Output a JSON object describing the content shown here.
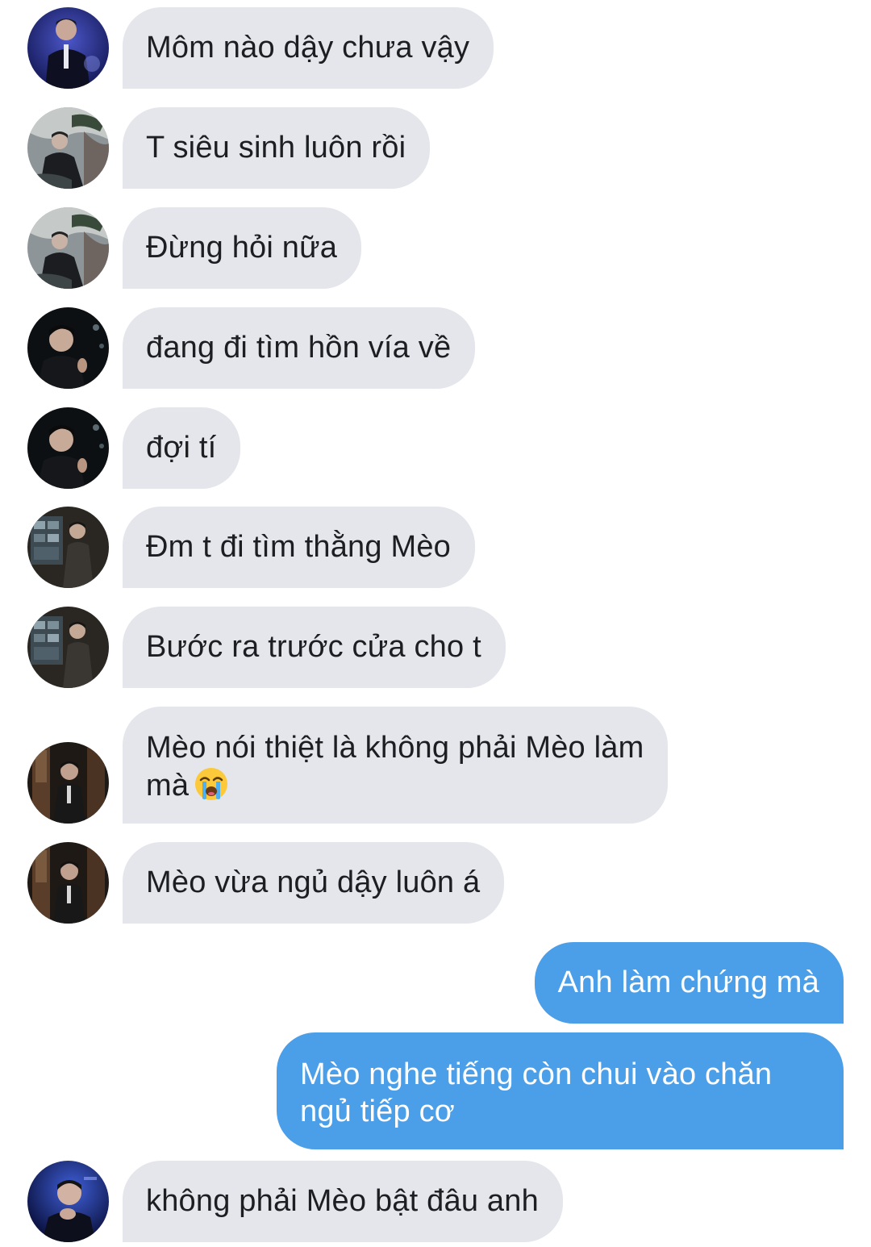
{
  "conversation": {
    "messages": [
      {
        "side": "in",
        "avatar": "avatar-stage-blue",
        "text": "Môm nào dậy chưa vậy"
      },
      {
        "side": "in",
        "avatar": "avatar-landscape",
        "text": "T siêu sinh luôn rồi"
      },
      {
        "side": "in",
        "avatar": "avatar-landscape",
        "text": "Đừng hỏi nữa"
      },
      {
        "side": "in",
        "avatar": "avatar-dark-portrait",
        "text": "đang đi tìm hồn vía về"
      },
      {
        "side": "in",
        "avatar": "avatar-dark-portrait",
        "text": "đợi tí"
      },
      {
        "side": "in",
        "avatar": "avatar-shop-suit",
        "text": "Đm t đi tìm thằng Mèo"
      },
      {
        "side": "in",
        "avatar": "avatar-shop-suit",
        "text": "Bước ra trước cửa cho t"
      },
      {
        "side": "in",
        "avatar": "avatar-doorway-suit",
        "text": "Mèo nói thiệt là không phải Mèo làm\nmà",
        "emoji": "loudly-crying-face-icon"
      },
      {
        "side": "in",
        "avatar": "avatar-doorway-suit",
        "text": "Mèo vừa ngủ dậy luôn á"
      },
      {
        "side": "out",
        "text": "Anh làm chứng mà"
      },
      {
        "side": "out",
        "text": "Mèo nghe tiếng còn chui vào chăn\nngủ tiếp cơ"
      },
      {
        "side": "in",
        "avatar": "avatar-stage-blue-thinking",
        "text": "không phải Mèo bật đâu anh"
      }
    ]
  },
  "colors": {
    "incoming_bubble": "#e4e6eb",
    "incoming_text": "#1c1e21",
    "outgoing_bubble": "#4b9ee8",
    "outgoing_text": "#ffffff",
    "background": "#ffffff"
  }
}
